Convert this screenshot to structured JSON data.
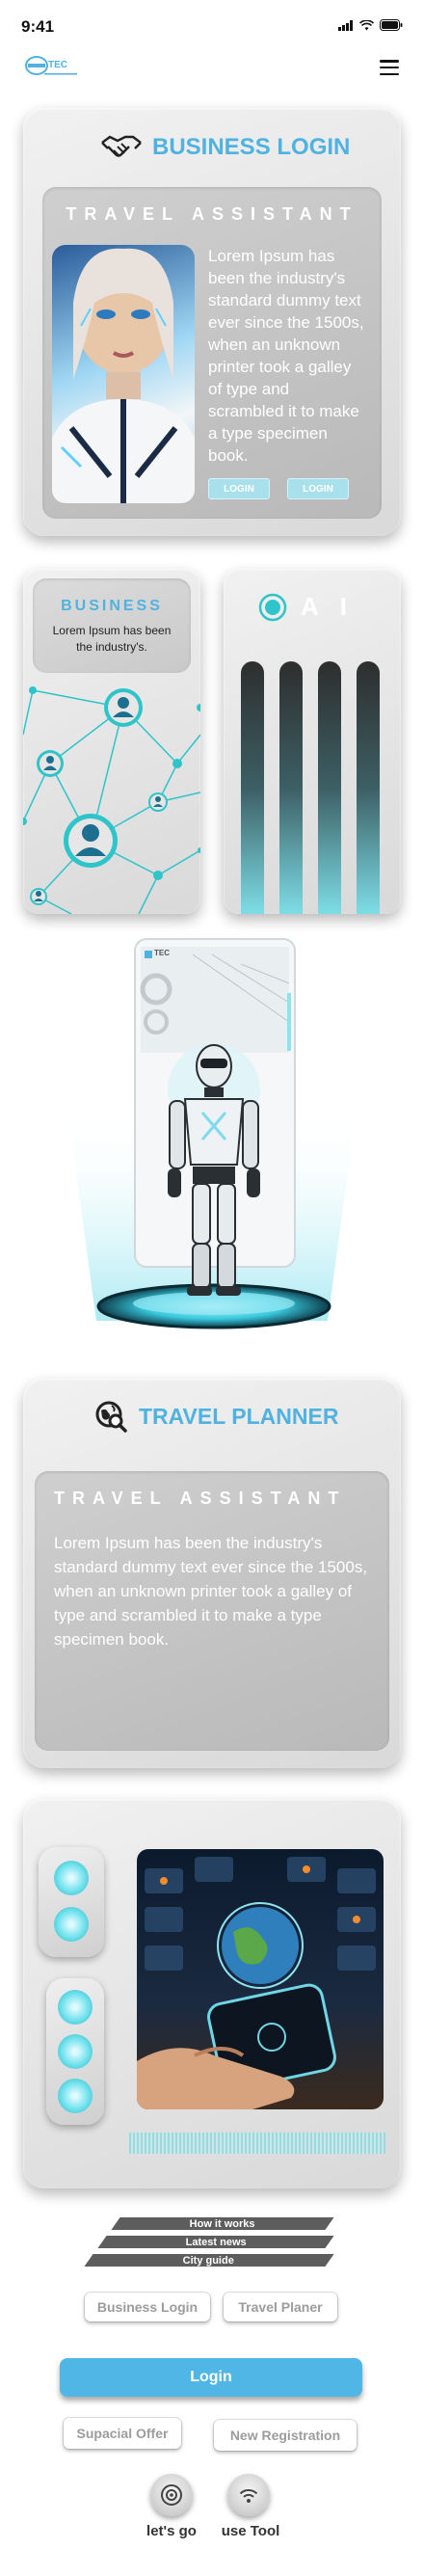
{
  "status": {
    "time": "9:41"
  },
  "header": {
    "logo_text": "TEC"
  },
  "business_login": {
    "title": "BUSINESS LOGIN",
    "subtitle": "TRAVEL ASSISTANT",
    "body": "Lorem Ipsum has been the industry's standard dummy text ever since the 1500s, when an unknown printer took a galley of type and scrambled it to make a type specimen book.",
    "button_1": "LOGIN",
    "button_2": "LOGIN"
  },
  "business_card": {
    "title": "BUSINESS",
    "body": "Lorem Ipsum has been the industry's."
  },
  "ai_card": {
    "title": "AI"
  },
  "robot": {
    "screen_logo": "TEC"
  },
  "travel_planner": {
    "title": "TRAVEL PLANNER",
    "subtitle": "TRAVEL ASSISTANT",
    "body": "Lorem Ipsum has been the industry's standard dummy text ever since the 1500s, when an unknown printer took a galley of type and scrambled it to make a type specimen book."
  },
  "menu_stripes": [
    "How it works",
    "Latest news",
    "City guide"
  ],
  "buttons": {
    "business_login": "Business Login",
    "travel_planer": "Travel Planer",
    "login": "Login",
    "special_offer": "Supacial Offer",
    "new_registration": "New Registration"
  },
  "footer": {
    "lets_go": "let's go",
    "use_tool": "use Tool"
  },
  "colors": {
    "accent": "#4fb2e0",
    "teal": "#2ec4c9",
    "card": "#e4e4e4"
  }
}
